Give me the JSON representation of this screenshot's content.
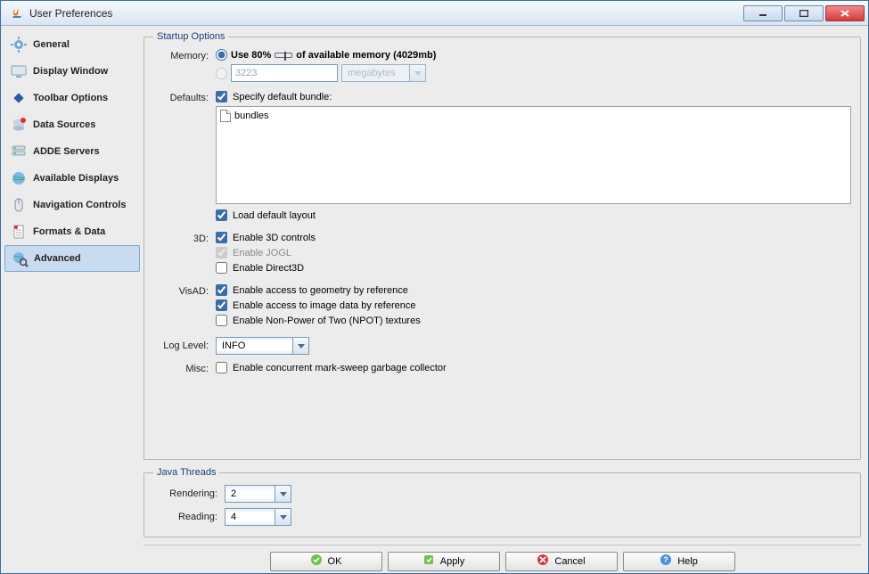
{
  "window": {
    "title": "User Preferences"
  },
  "sidebar": {
    "items": [
      {
        "label": "General"
      },
      {
        "label": "Display Window"
      },
      {
        "label": "Toolbar Options"
      },
      {
        "label": "Data Sources"
      },
      {
        "label": "ADDE Servers"
      },
      {
        "label": "Available Displays"
      },
      {
        "label": "Navigation Controls"
      },
      {
        "label": "Formats & Data"
      },
      {
        "label": "Advanced"
      }
    ]
  },
  "startup": {
    "legend": "Startup Options",
    "memory_label": "Memory:",
    "use80_prefix": "Use 80%",
    "use80_suffix": "of available memory (4029mb)",
    "custom_value": "3223",
    "custom_unit": "megabytes",
    "defaults_label": "Defaults:",
    "specify_bundle": "Specify default bundle:",
    "bundle_item": "bundles",
    "load_default_layout": "Load default layout",
    "threeD_label": "3D:",
    "enable_3d": "Enable 3D controls",
    "enable_jogl": "Enable JOGL",
    "enable_d3d": "Enable Direct3D",
    "visad_label": "VisAD:",
    "geom_ref": "Enable access to geometry by reference",
    "image_ref": "Enable access to image data by reference",
    "npot": "Enable Non-Power of Two (NPOT) textures",
    "loglevel_label": "Log Level:",
    "loglevel_value": "INFO",
    "misc_label": "Misc:",
    "misc_cms": "Enable concurrent mark-sweep garbage collector"
  },
  "threads": {
    "legend": "Java Threads",
    "rendering_label": "Rendering:",
    "rendering_value": "2",
    "reading_label": "Reading:",
    "reading_value": "4"
  },
  "buttons": {
    "ok": "OK",
    "apply": "Apply",
    "cancel": "Cancel",
    "help": "Help"
  }
}
